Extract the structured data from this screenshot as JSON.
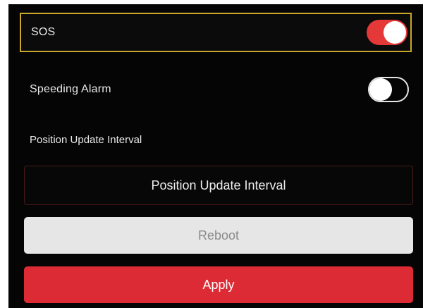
{
  "settings": {
    "sos": {
      "label": "SOS",
      "enabled": true
    },
    "speeding_alarm": {
      "label": "Speeding Alarm",
      "enabled": false
    },
    "position_update": {
      "section_label": "Position Update Interval",
      "field_text": "Position Update Interval"
    }
  },
  "actions": {
    "reboot_label": "Reboot",
    "apply_label": "Apply"
  },
  "colors": {
    "accent": "#dd2b35",
    "toggle_on": "#e53838",
    "focus_border": "#c9a72a",
    "background": "#050505"
  }
}
